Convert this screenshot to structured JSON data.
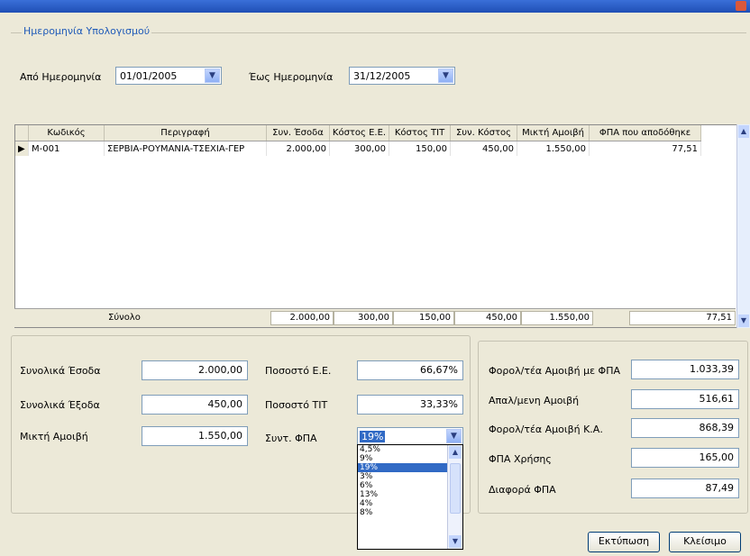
{
  "date_group": {
    "legend": "Ημερομηνία Υπολογισμού",
    "from_label": "Από Ημερομηνία",
    "from_value": "01/01/2005",
    "to_label": "Έως Ημερομηνία",
    "to_value": "31/12/2005"
  },
  "grid": {
    "columns": [
      "Κωδικός",
      "Περιγραφή",
      "Συν. Έσοδα",
      "Κόστος Ε.Ε.",
      "Κόστος ΤΙΤ",
      "Συν. Κόστος",
      "Μικτή Αμοιβή",
      "ΦΠΑ που αποδόθηκε"
    ],
    "rows": [
      [
        "M-001",
        "ΣΕΡΒΙΑ-ΡΟΥΜΑΝΙΑ-ΤΣΕΧΙΑ-ΓΕΡ",
        "2.000,00",
        "300,00",
        "150,00",
        "450,00",
        "1.550,00",
        "77,51"
      ]
    ],
    "totals_label": "Σύνολο",
    "totals": [
      "2.000,00",
      "300,00",
      "150,00",
      "450,00",
      "1.550,00",
      "77,51"
    ]
  },
  "summary": {
    "total_income_label": "Συνολικά Έσοδα",
    "total_income": "2.000,00",
    "total_expenses_label": "Συνολικά Έξοδα",
    "total_expenses": "450,00",
    "gross_fee_label": "Μικτή Αμοιβή",
    "gross_fee": "1.550,00",
    "pct_ee_label": "Ποσοστό Ε.Ε.",
    "pct_ee": "66,67%",
    "pct_tit_label": "Ποσοστό ΤΙΤ",
    "pct_tit": "33,33%",
    "vat_rate_label": "Συντ. ΦΠΑ",
    "vat_rate": "19%",
    "vat_options": [
      "4,5%",
      "9%",
      "19%",
      "3%",
      "6%",
      "13%",
      "4%",
      "8%"
    ],
    "vat_selected_index": 2
  },
  "vat_box": {
    "taxable_fee_vat_label": "Φορολ/τέα Αμοιβή με ΦΠΑ",
    "taxable_fee_vat": "1.033,39",
    "deducted_fee_label": "Απαλ/μενη Αμοιβή",
    "deducted_fee": "516,61",
    "taxable_fee_ka_label": "Φορολ/τέα Αμοιβή Κ.Α.",
    "taxable_fee_ka": "868,39",
    "vat_charge_label": "ΦΠΑ Χρήσης",
    "vat_charge": "165,00",
    "vat_diff_label": "Διαφορά ΦΠΑ",
    "vat_diff": "87,49"
  },
  "buttons": {
    "print": "Εκτύπωση",
    "close": "Κλείσιμο"
  }
}
